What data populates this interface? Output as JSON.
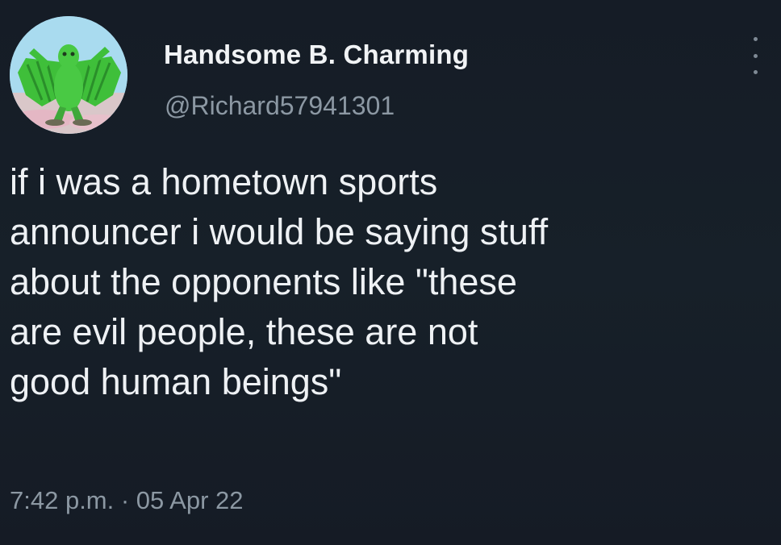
{
  "tweet": {
    "author_name": "Handsome B. Charming",
    "author_handle": "@Richard57941301",
    "avatar_icon": "green-creature-avatar",
    "text": "if i was a hometown sports\nannouncer i would be saying stuff\nabout the opponents like \"these\nare evil people, these are not\ngood human beings\"",
    "timestamp": "7:42 p.m. · 05 Apr 22",
    "more_icon": "vertical-ellipsis-icon"
  },
  "colors": {
    "background": "#151c26",
    "text": "#eef1f4",
    "secondary_text": "#8c98a3"
  }
}
